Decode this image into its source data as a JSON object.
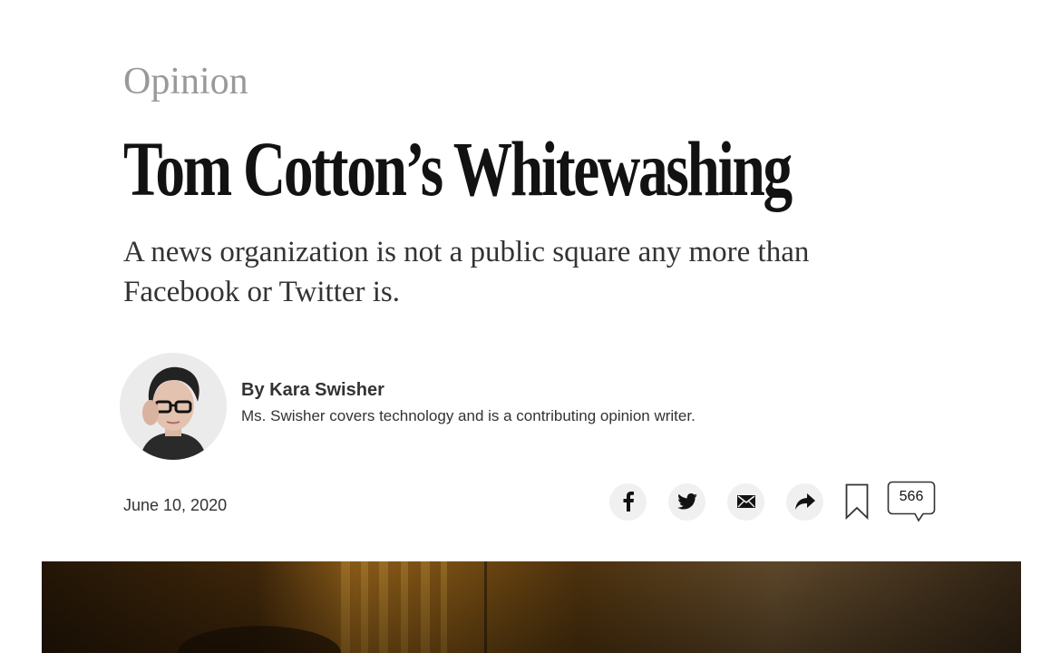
{
  "article": {
    "section": "Opinion",
    "headline": "Tom Cotton’s Whitewashing",
    "summary": "A news organization is not a public square any more than Facebook or Twitter is.",
    "byline": {
      "name": "By Kara Swisher",
      "bio": "Ms. Swisher covers technology and is a contributing opinion writer."
    },
    "date": "June 10, 2020"
  },
  "share_tools": {
    "items": [
      {
        "icon": "facebook-icon"
      },
      {
        "icon": "twitter-icon"
      },
      {
        "icon": "email-icon"
      },
      {
        "icon": "share-arrow-icon"
      },
      {
        "icon": "bookmark-icon"
      }
    ],
    "comments_count": "566"
  },
  "colors": {
    "section_gray": "#999999",
    "headline": "#121212",
    "body_text": "#333333",
    "share_button_bg": "#f0f0f0"
  }
}
